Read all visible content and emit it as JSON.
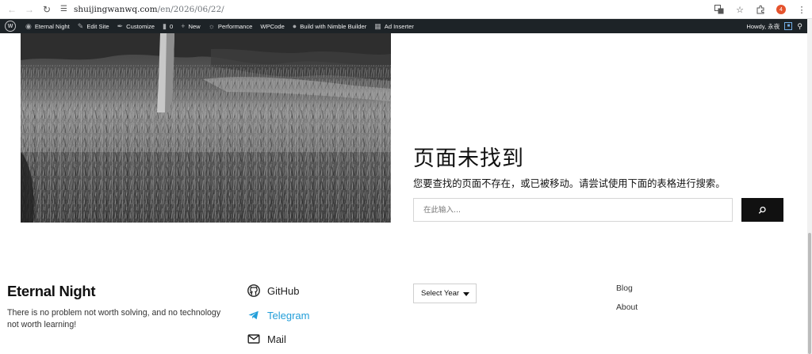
{
  "browser": {
    "url_host": "shuijingwanwq.com",
    "url_path": "/en/2026/06/22/",
    "extension_badge": "4"
  },
  "adminbar": {
    "site_name": "Eternal Night",
    "edit_site": "Edit Site",
    "customize": "Customize",
    "comments_count": "0",
    "new": "New",
    "performance": "Performance",
    "wpcode": "WPCode",
    "nimble": "Build with Nimble Builder",
    "ad_inserter": "Ad Inserter",
    "howdy": "Howdy, 永夜"
  },
  "not_found": {
    "title": "页面未找到",
    "description": "您要查找的页面不存在，或已被移动。请尝试使用下面的表格进行搜索。",
    "search_placeholder": "在此输入..."
  },
  "footer": {
    "site_title": "Eternal Night",
    "tagline": "There is no problem not worth solving, and no technology not worth learning!",
    "social": {
      "github": "GitHub",
      "telegram": "Telegram",
      "mail": "Mail"
    },
    "archive_select": "Select Year",
    "links": [
      "Blog",
      "About"
    ],
    "telegram_color": "#229ed9"
  }
}
